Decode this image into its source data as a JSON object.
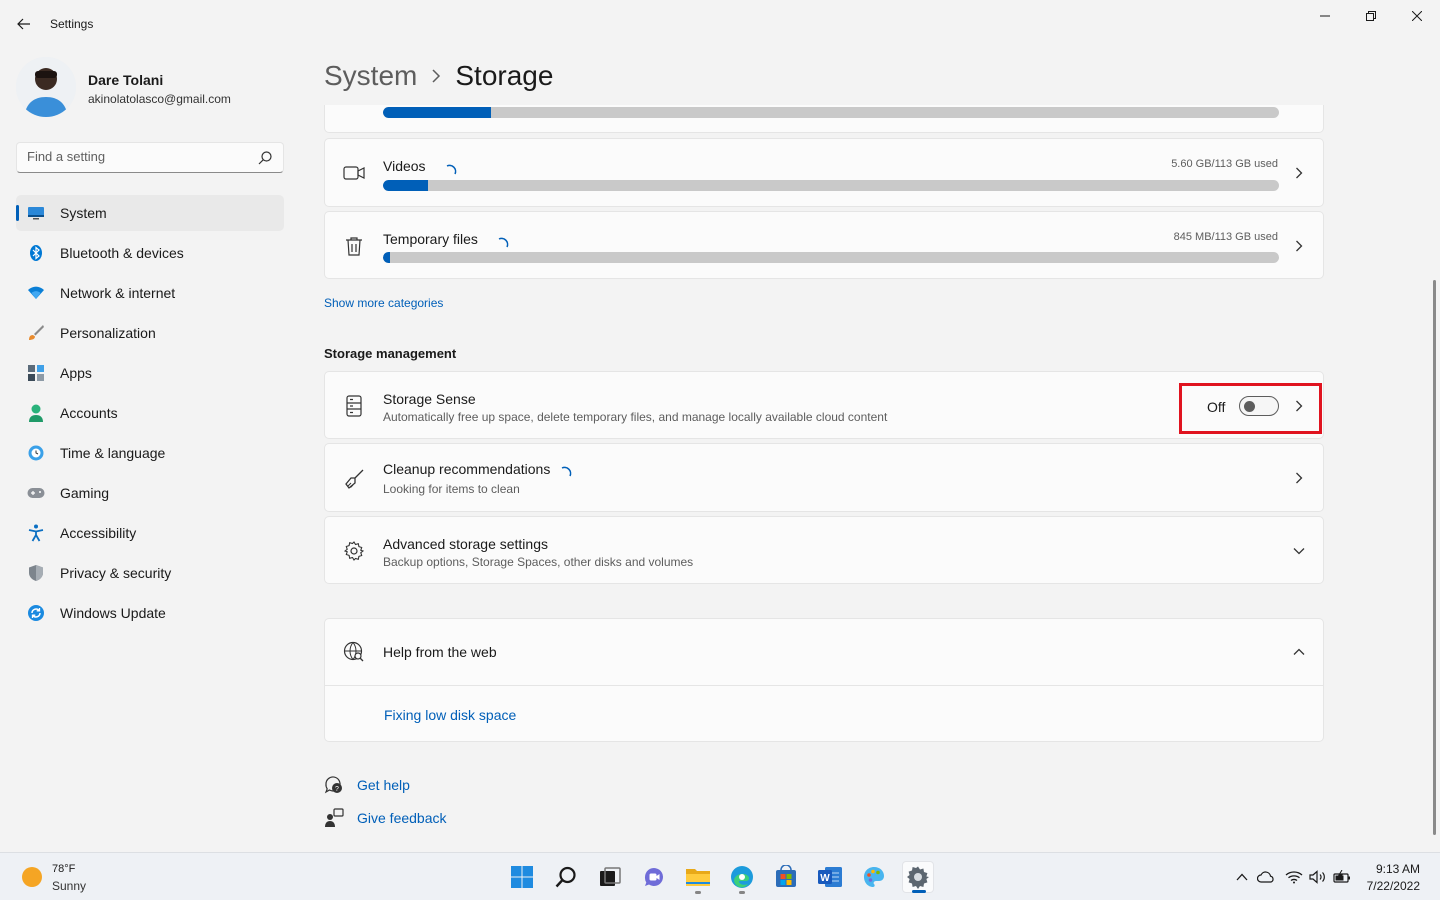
{
  "window": {
    "title": "Settings"
  },
  "profile": {
    "name": "Dare Tolani",
    "email": "akinolatolasco@gmail.com"
  },
  "search": {
    "placeholder": "Find a setting"
  },
  "sidebar": {
    "items": [
      {
        "label": "System",
        "icon": "monitor-icon",
        "active": true
      },
      {
        "label": "Bluetooth & devices",
        "icon": "bluetooth-icon"
      },
      {
        "label": "Network & internet",
        "icon": "wifi-icon"
      },
      {
        "label": "Personalization",
        "icon": "paintbrush-icon"
      },
      {
        "label": "Apps",
        "icon": "apps-icon"
      },
      {
        "label": "Accounts",
        "icon": "person-icon"
      },
      {
        "label": "Time & language",
        "icon": "clock-globe-icon"
      },
      {
        "label": "Gaming",
        "icon": "gamepad-icon"
      },
      {
        "label": "Accessibility",
        "icon": "accessibility-icon"
      },
      {
        "label": "Privacy & security",
        "icon": "shield-icon"
      },
      {
        "label": "Windows Update",
        "icon": "update-icon"
      }
    ]
  },
  "breadcrumb": {
    "parent": "System",
    "current": "Storage"
  },
  "categories": [
    {
      "name": "",
      "usage": "",
      "fill_fraction": 0.12,
      "icon": "apps-icon"
    },
    {
      "name": "Videos",
      "usage": "5.60 GB/113 GB used",
      "fill_fraction": 0.05,
      "icon": "video-icon"
    },
    {
      "name": "Temporary files",
      "usage": "845 MB/113 GB used",
      "fill_fraction": 0.008,
      "icon": "trash-icon"
    }
  ],
  "show_more": "Show more categories",
  "storage_management": {
    "heading": "Storage management",
    "storage_sense": {
      "title": "Storage Sense",
      "subtitle": "Automatically free up space, delete temporary files, and manage locally available cloud content",
      "toggle_label": "Off",
      "toggle_on": false
    },
    "cleanup": {
      "title": "Cleanup recommendations",
      "subtitle": "Looking for items to clean"
    },
    "advanced": {
      "title": "Advanced storage settings",
      "subtitle": "Backup options, Storage Spaces, other disks and volumes"
    }
  },
  "help": {
    "title": "Help from the web",
    "link": "Fixing low disk space"
  },
  "footer": {
    "get_help": "Get help",
    "give_feedback": "Give feedback"
  },
  "taskbar": {
    "weather_temp": "78°F",
    "weather_desc": "Sunny",
    "apps": [
      "start-icon",
      "search-icon",
      "task-view-icon",
      "chat-icon",
      "file-explorer-icon",
      "edge-icon",
      "store-icon",
      "word-icon",
      "paint-icon",
      "settings-icon"
    ],
    "time": "9:13 AM",
    "date": "7/22/2022"
  },
  "colors": {
    "accent": "#005fb8",
    "highlight_box": "#e0131f",
    "background": "#f3f3f3",
    "card": "#fbfbfb"
  }
}
